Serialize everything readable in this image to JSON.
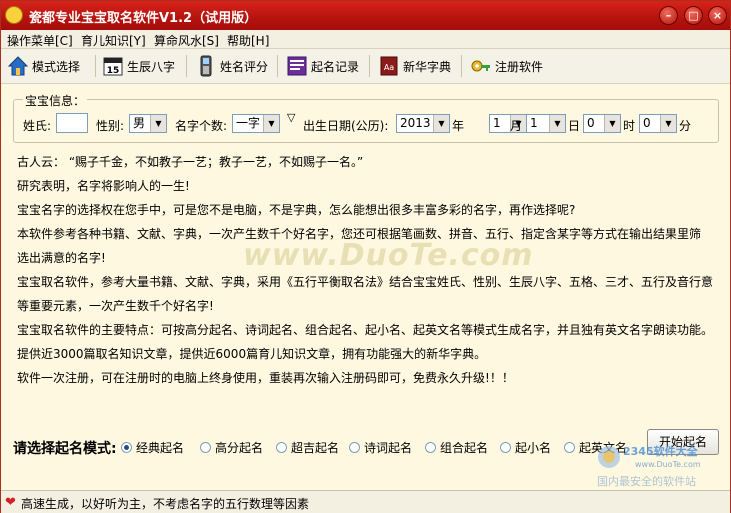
{
  "window": {
    "title": "瓷都专业宝宝取名软件V1.2（试用版）"
  },
  "menu": [
    {
      "label": "操作菜单[C]"
    },
    {
      "label": "育儿知识[Y]"
    },
    {
      "label": "算命风水[S]"
    },
    {
      "label": "帮助[H]"
    }
  ],
  "toolbar": [
    {
      "label": "模式选择",
      "icon": "house-icon"
    },
    {
      "label": "生辰八字",
      "icon": "calendar-icon"
    },
    {
      "label": "姓名评分",
      "icon": "phone-icon"
    },
    {
      "label": "起名记录",
      "icon": "record-icon"
    },
    {
      "label": "新华字典",
      "icon": "dictionary-icon"
    },
    {
      "label": "注册软件",
      "icon": "key-icon"
    }
  ],
  "info": {
    "legend": "宝宝信息：",
    "surname_label": "姓氏:",
    "surname_value": "",
    "gender_label": "性别:",
    "gender_value": "男",
    "namelen_label": "名字个数:",
    "namelen_value": "一字",
    "birth_label": "出生日期(公历):",
    "year_value": "2013",
    "year_unit": "年",
    "month_value": "1",
    "month_unit": "月",
    "day_value": "1",
    "day_unit": "日",
    "hour_value": "0",
    "hour_unit": "时",
    "minute_value": "0",
    "minute_unit": "分"
  },
  "content": [
    "古人云：  “赐子千金，不如教子一艺；教子一艺，不如赐子一名。”",
    "研究表明，名字将影响人的一生!",
    "宝宝名字的选择权在您手中，可是您不是电脑，不是字典，怎么能想出很多丰富多彩的名字，再作选择呢?",
    "本软件参考各种书籍、文献、字典，一次产生数千个好名字，您还可根据笔画数、拼音、五行、指定含某字等方式在输出结果里筛",
    "选出满意的名字!",
    "宝宝取名软件，参考大量书籍、文献、字典，采用《五行平衡取名法》结合宝宝姓氏、性别、生辰八字、五格、三才、五行及音行意",
    "等重要元素，一次产生数千个好名字!",
    "宝宝取名软件的主要特点：可按高分起名、诗词起名、组合起名、起小名、起英文名等模式生成名字，并且独有英文名字朗读功能。",
    "提供近3000篇取名知识文章，提供近6000篇育儿知识文章，拥有功能强大的新华字典。",
    "软件一次注册，可在注册时的电脑上终身使用，重装再次输入注册码即可，免费永久升级!！！"
  ],
  "watermark": "www.DuoTe.com",
  "mode": {
    "title": "请选择起名模式:",
    "options": [
      {
        "label": "经典起名",
        "selected": true
      },
      {
        "label": "高分起名",
        "selected": false
      },
      {
        "label": "超吉起名",
        "selected": false
      },
      {
        "label": "诗词起名",
        "selected": false
      },
      {
        "label": "组合起名",
        "selected": false
      },
      {
        "label": "起小名",
        "selected": false
      },
      {
        "label": "起英文名",
        "selected": false
      }
    ],
    "start_label": "开始起名"
  },
  "status": {
    "text": "高速生成，以好听为主，不考虑名字的五行数理等因素"
  },
  "logo": {
    "line1": "2345软件大全",
    "line2": "www.DuoTe.com",
    "line3": "国内最安全的软件站"
  },
  "colors": {
    "titlebar": "#c41a12",
    "background": "#fdf8df"
  }
}
